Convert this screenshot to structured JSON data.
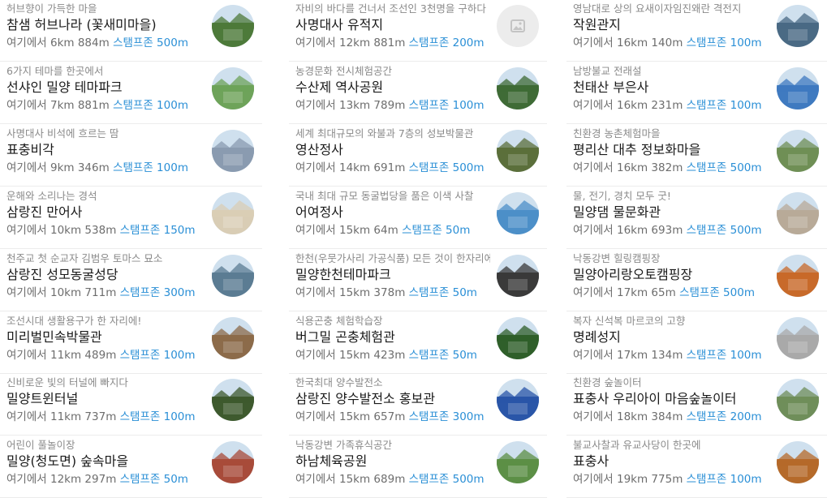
{
  "meta_prefix": "여기에서",
  "stamp_prefix": "스탬프존",
  "columns": [
    {
      "items": [
        {
          "subtitle": "허브향이 가득한 마을",
          "name": "참샘 허브나라 (꽃새미마을)",
          "distance": "6km 884m",
          "stamp": "500m"
        },
        {
          "subtitle": "6가지 테마를 한곳에서",
          "name": "선샤인 밀양 테마파크",
          "distance": "7km 881m",
          "stamp": "100m"
        },
        {
          "subtitle": "사명대사 비석에 흐르는 땀",
          "name": "표충비각",
          "distance": "9km 346m",
          "stamp": "100m"
        },
        {
          "subtitle": "운해와 소리나는 경석",
          "name": "삼랑진 만어사",
          "distance": "10km 538m",
          "stamp": "150m"
        },
        {
          "subtitle": "천주교 첫 순교자 김범우 토마스 묘소",
          "name": "삼랑진 성모동굴성당",
          "distance": "10km 711m",
          "stamp": "300m"
        },
        {
          "subtitle": "조선시대 생활용구가 한 자리에!",
          "name": "미리벌민속박물관",
          "distance": "11km 489m",
          "stamp": "100m"
        },
        {
          "subtitle": "신비로운 빛의 터널에 빠지다",
          "name": "밀양트윈터널",
          "distance": "11km 737m",
          "stamp": "100m"
        },
        {
          "subtitle": "어린이 풀놀이장",
          "name": "밀양(청도면) 숲속마을",
          "distance": "12km 297m",
          "stamp": "50m"
        }
      ]
    },
    {
      "items": [
        {
          "subtitle": "자비의 바다를 건너서 조선인 3천명을 구하다",
          "name": "사명대사 유적지",
          "distance": "12km 881m",
          "stamp": "200m"
        },
        {
          "subtitle": "농경문화 전시체험공간",
          "name": "수산제 역사공원",
          "distance": "13km 789m",
          "stamp": "100m"
        },
        {
          "subtitle": "세계 최대규모의 와불과 7층의 성보박물관",
          "name": "영산정사",
          "distance": "14km 691m",
          "stamp": "500m"
        },
        {
          "subtitle": "국내 최대 규모 동굴법당을 품은 이색 사찰",
          "name": "어여정사",
          "distance": "15km 64m",
          "stamp": "50m"
        },
        {
          "subtitle": "한천(우뭇가사리 가공식품) 모든 것이 한자리에",
          "name": "밀양한천테마파크",
          "distance": "15km 378m",
          "stamp": "50m"
        },
        {
          "subtitle": "식용곤충 체험학습장",
          "name": "버그밀 곤충체험관",
          "distance": "15km 423m",
          "stamp": "50m"
        },
        {
          "subtitle": "한국최대 양수발전소",
          "name": "삼랑진 양수발전소 홍보관",
          "distance": "15km 657m",
          "stamp": "300m"
        },
        {
          "subtitle": "낙동강변 가족휴식공간",
          "name": "하남체육공원",
          "distance": "15km 689m",
          "stamp": "500m"
        }
      ]
    },
    {
      "items": [
        {
          "subtitle": "영남대로 상의 요새이자임진왜란 격전지",
          "name": "작원관지",
          "distance": "16km 140m",
          "stamp": "100m"
        },
        {
          "subtitle": "남방불교 전래설",
          "name": "천태산 부은사",
          "distance": "16km 231m",
          "stamp": "100m"
        },
        {
          "subtitle": "친환경 농촌체험마을",
          "name": "평리산 대추 정보화마을",
          "distance": "16km 382m",
          "stamp": "500m"
        },
        {
          "subtitle": "물, 전기, 경치 모두 굿!",
          "name": "밀양댐 물문화관",
          "distance": "16km 693m",
          "stamp": "500m"
        },
        {
          "subtitle": "낙동강변 힐링캠핑장",
          "name": "밀양아리랑오토캠핑장",
          "distance": "17km 65m",
          "stamp": "500m"
        },
        {
          "subtitle": "복자 신석복 마르코의 고향",
          "name": "명례성지",
          "distance": "17km 134m",
          "stamp": "100m"
        },
        {
          "subtitle": "친환경 숲놀이터",
          "name": "표충사 우리아이 마음숲놀이터",
          "distance": "18km 384m",
          "stamp": "200m"
        },
        {
          "subtitle": "불교사찰과 유교사당이 한곳에",
          "name": "표충사",
          "distance": "19km 775m",
          "stamp": "100m"
        }
      ]
    }
  ],
  "thumb_colors": [
    [
      "#4d7a3a",
      "#6ea35a",
      "#8a9bb0",
      "#d9cdb5",
      "#5b7c93",
      "#8c6b4a",
      "#3e5a2e",
      "#a84b3a"
    ],
    [
      "#d8d8d8",
      "#3f6b36",
      "#5b6f3b",
      "#4c8fc8",
      "#3a3a3a",
      "#2f5f2a",
      "#2a56a8",
      "#5c8f46"
    ],
    [
      "#4a6a84",
      "#3f7ac0",
      "#6f8f55",
      "#b8aa98",
      "#c86a2a",
      "#a9a9a9",
      "#6f8e5a",
      "#b56a2a"
    ]
  ],
  "placeholder_icon": "image-icon"
}
